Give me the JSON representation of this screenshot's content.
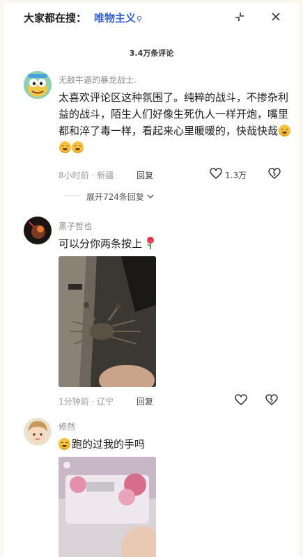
{
  "header": {
    "search_prefix": "大家都在搜：",
    "search_term": "唯物主义",
    "search_icon": "search-icon",
    "shrink_icon": "shrink-icon",
    "close_icon": "close-icon"
  },
  "comment_count": "3.4万条评论",
  "comments": [
    {
      "username": "无敌牛逼的暴龙战士.",
      "text": "太喜欢评论区这种氛围了。纯粹的战斗，不掺杂利益的战斗，陌生人们好像生死仇人一样开炮，嘴里都和淬了毒一样，看起来心里暖暖的，快哉快哉",
      "emoji": [
        "smile-emoji",
        "smile-emoji",
        "smile-emoji"
      ],
      "time": "8小时前",
      "location": "新疆",
      "reply_label": "回复",
      "likes": "1.3万",
      "expand_label": "展开724条回复"
    },
    {
      "username": "黑子哲也",
      "text": "可以分你两条按上",
      "emoji": [
        "rose-emoji"
      ],
      "time": "1分钟前",
      "location": "辽宁",
      "reply_label": "回复",
      "likes": ""
    },
    {
      "username": "修然",
      "text": "跑的过我的手吗",
      "emoji": [
        "smile-emoji"
      ]
    }
  ],
  "colors": {
    "accent": "#2f5fd0",
    "muted": "#999999",
    "background": "#fbf7ee"
  }
}
